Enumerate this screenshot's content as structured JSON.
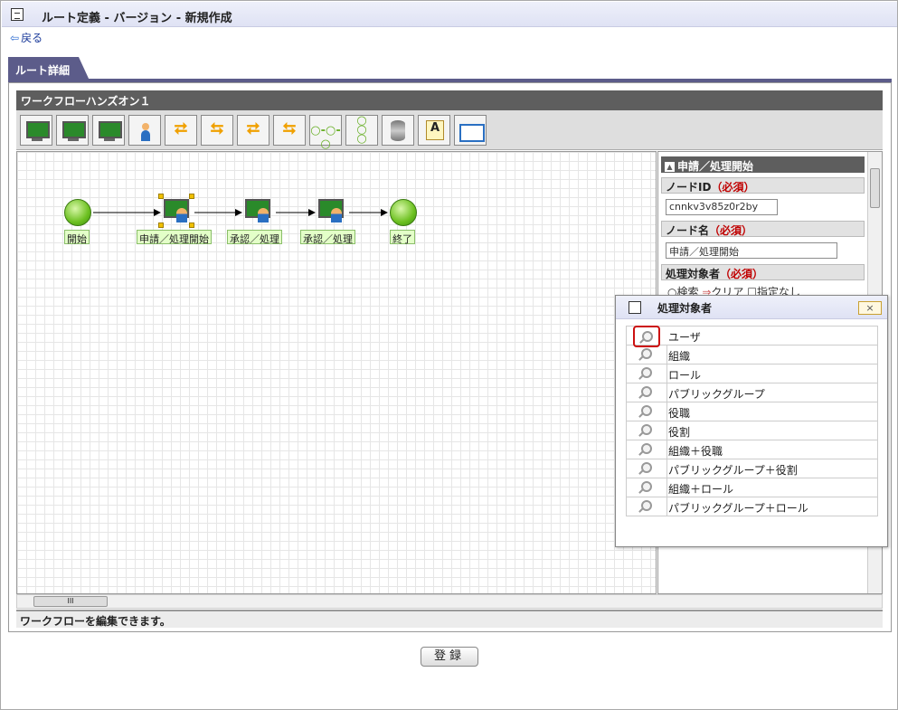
{
  "header": {
    "title": "ルート定義 - バージョン - 新規作成",
    "back_label": "戻る"
  },
  "tab": {
    "label": "ルート詳細"
  },
  "workflow": {
    "name": "ワークフローハンズオン１"
  },
  "toolbar_icons": [
    "task-icon",
    "task-icon",
    "monitor-icon",
    "user-icon",
    "branch-icon",
    "merge-icon",
    "branch-icon",
    "merge-icon",
    "connector-icon",
    "vertical-connector-icon",
    "database-icon",
    "text-icon",
    "window-icon"
  ],
  "nodes": [
    {
      "label": "開始",
      "type": "start"
    },
    {
      "label": "申請／処理開始",
      "type": "task",
      "selected": true
    },
    {
      "label": "承認／処理",
      "type": "task"
    },
    {
      "label": "承認／処理",
      "type": "task"
    },
    {
      "label": "終了",
      "type": "end"
    }
  ],
  "properties": {
    "section_title": "申請／処理開始",
    "node_id": {
      "label": "ノードID",
      "required": "（必須）",
      "value": "cnnkv3v85z0r2by"
    },
    "node_name": {
      "label": "ノード名",
      "required": "（必須）",
      "value": "申請／処理開始"
    },
    "target": {
      "label": "処理対象者",
      "required": "（必須）",
      "search": "検索",
      "clear": "クリア",
      "none": "指定なし"
    }
  },
  "popup": {
    "title": "処理対象者",
    "close": "×",
    "items": [
      "ユーザ",
      "組織",
      "ロール",
      "パブリックグループ",
      "役職",
      "役割",
      "組織＋役職",
      "パブリックグループ＋役割",
      "組織＋ロール",
      "パブリックグループ＋ロール"
    ]
  },
  "status": "ワークフローを編集できます。",
  "register_label": "登録",
  "hscroll_thumb": "III"
}
